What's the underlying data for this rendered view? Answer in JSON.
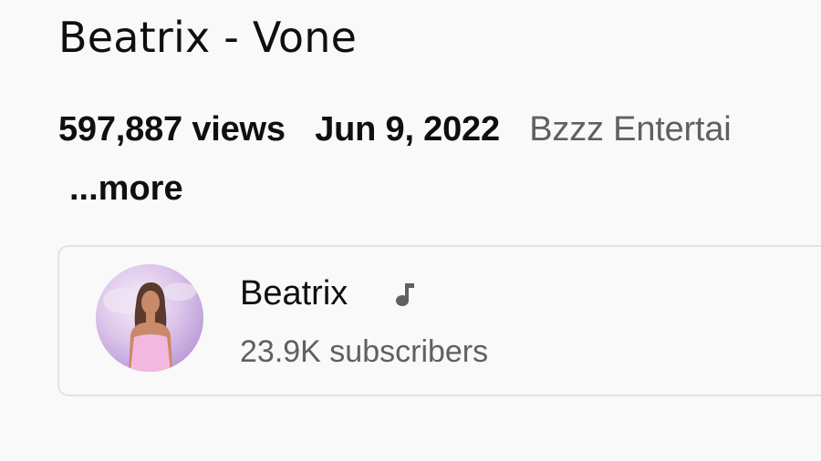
{
  "video": {
    "title": "Beatrix - Vone",
    "views": "597,887 views",
    "date": "Jun 9, 2022",
    "channel_link_text": "Bzzz Entertai",
    "more_label": "...more"
  },
  "channel": {
    "name": "Beatrix",
    "subscribers": "23.9K subscribers",
    "badge_icon": "music-note-icon",
    "avatar_colors": {
      "background": "#d8c3e8",
      "dress": "#f2b8e0",
      "hair": "#5a3a2c",
      "skin": "#c98a6a"
    }
  },
  "colors": {
    "primary_text": "#0f0f0f",
    "secondary_text": "#606060",
    "card_border": "#e3e3e3",
    "background": "#f9f9f9"
  }
}
